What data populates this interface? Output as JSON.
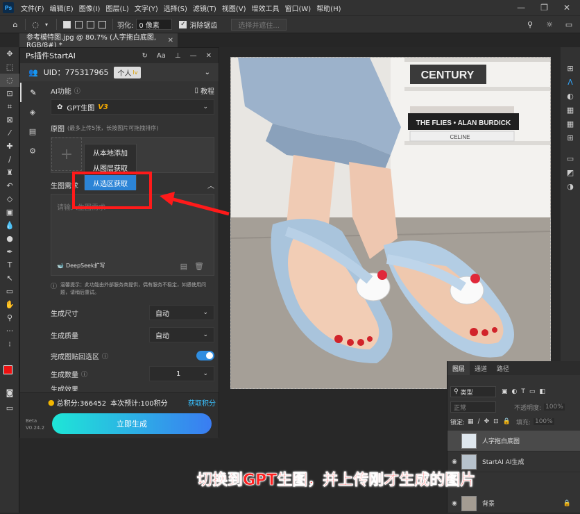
{
  "menubar": {
    "items": [
      "文件(F)",
      "编辑(E)",
      "图像(I)",
      "图层(L)",
      "文字(Y)",
      "选择(S)",
      "滤镜(T)",
      "视图(V)",
      "增效工具",
      "窗口(W)",
      "帮助(H)"
    ],
    "logo": "Ps"
  },
  "optbar": {
    "feather_label": "羽化:",
    "feather_value": "0 像素",
    "antialias_label": "消除锯齿",
    "select_subject": "选择并遮住..."
  },
  "tab": {
    "title": "参考模特图.jpg @ 80.7% (人字拖白底图, RGB/8#) *"
  },
  "plugin": {
    "title": "Ps插件StartAI",
    "uid": "UID：775317965",
    "account_type": "个人",
    "level": "lv",
    "ai_func_label": "AI功能",
    "tutorial": "教程",
    "model": "GPT生图",
    "model_version": "V3",
    "original_label": "原图",
    "original_hint": "(最多上传5张，长按图片可拖拽排序)",
    "upload_menu": [
      "从本地添加",
      "从图层获取",
      "从选区获取"
    ],
    "prompt_label": "生图需求",
    "prompt_placeholder": "请输入生图需求",
    "deepseek": "DeepSeek扩写",
    "tip": "温馨提示：此功能由外部服务商提供，偶有服务不稳定，如遇使用问题，请稍后重试。",
    "size_label": "生成尺寸",
    "size_value": "自动",
    "quality_label": "生成质量",
    "quality_value": "自动",
    "paste_label": "完成图贴回选区",
    "count_label": "生成数量",
    "count_value": "1",
    "effect_label": "生成效果",
    "total_points": "总积分:366452",
    "estimate": "本次预计:100积分",
    "get_points": "获取积分",
    "generate": "立即生成",
    "beta": "Beta",
    "version": "V0.24.2"
  },
  "layers": {
    "tabs": [
      "图层",
      "通道",
      "路径"
    ],
    "filter": "类型",
    "blend": "正常",
    "opacity_label": "不透明度:",
    "opacity": "100%",
    "lock_label": "锁定:",
    "fill_label": "填充:",
    "fill": "100%",
    "items": [
      "人字拖白底图",
      "StartAI AI生成",
      "背景"
    ]
  },
  "canvas": {
    "book_spine_1": "CENTURY",
    "book_spine_2": "THE FLIES • ALAN BURDICK",
    "book_spine_3": "CELINE"
  },
  "caption": "切换到GPT生图，并上传刚才生成的图片",
  "colors": {
    "accent": "#2c84d6",
    "annotation": "#ff1a1a"
  }
}
